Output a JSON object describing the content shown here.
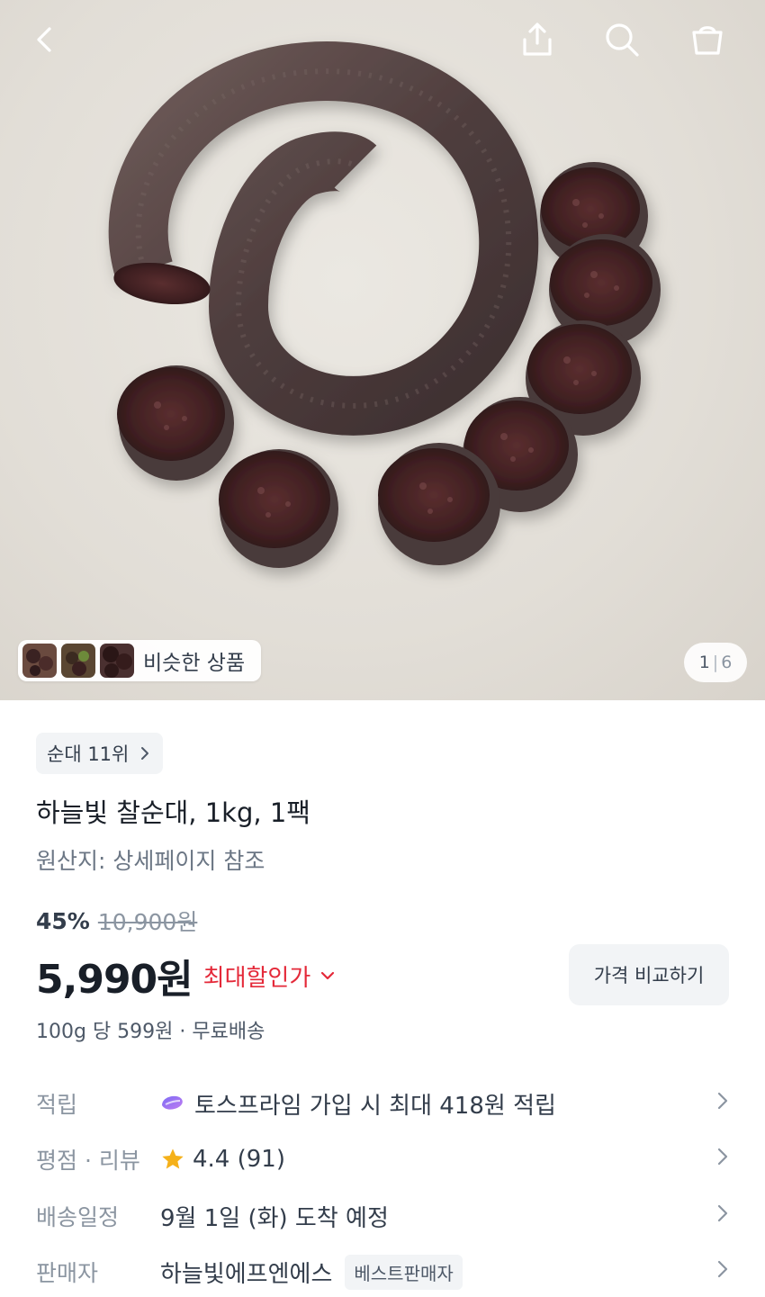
{
  "hero": {
    "similar_label": "비슷한 상품",
    "page_current": "1",
    "page_sep": "|",
    "page_total": "6"
  },
  "top_bar": {
    "icons": [
      "back-icon",
      "share-icon",
      "search-icon",
      "cart-icon"
    ]
  },
  "product": {
    "rank_label": "순대 11위",
    "title": "하늘빛 찰순대, 1kg, 1팩",
    "origin": "원산지: 상세페이지 참조",
    "discount_rate": "45%",
    "original_price": "10,900원",
    "price": "5,990원",
    "max_discount_label": "최대할인가",
    "compare_button": "가격 비교하기",
    "unit_price": "100g 당 599원 · 무료배송"
  },
  "info_rows": {
    "points": {
      "label": "적립",
      "value": "토스프라임 가입 시 최대 418원 적립"
    },
    "rating": {
      "label": "평점 · 리뷰",
      "value": "4.4 (91)"
    },
    "delivery": {
      "label": "배송일정",
      "value": "9월 1일 (화) 도착 예정"
    },
    "seller": {
      "label": "판매자",
      "value": "하늘빛에프엔에스",
      "badge": "베스트판매자"
    }
  },
  "colors": {
    "accent_red": "#e42939",
    "star": "#f5b11a",
    "chip_bg": "#f2f4f6",
    "text_primary": "#191f28",
    "text_secondary": "#8b95a1"
  }
}
